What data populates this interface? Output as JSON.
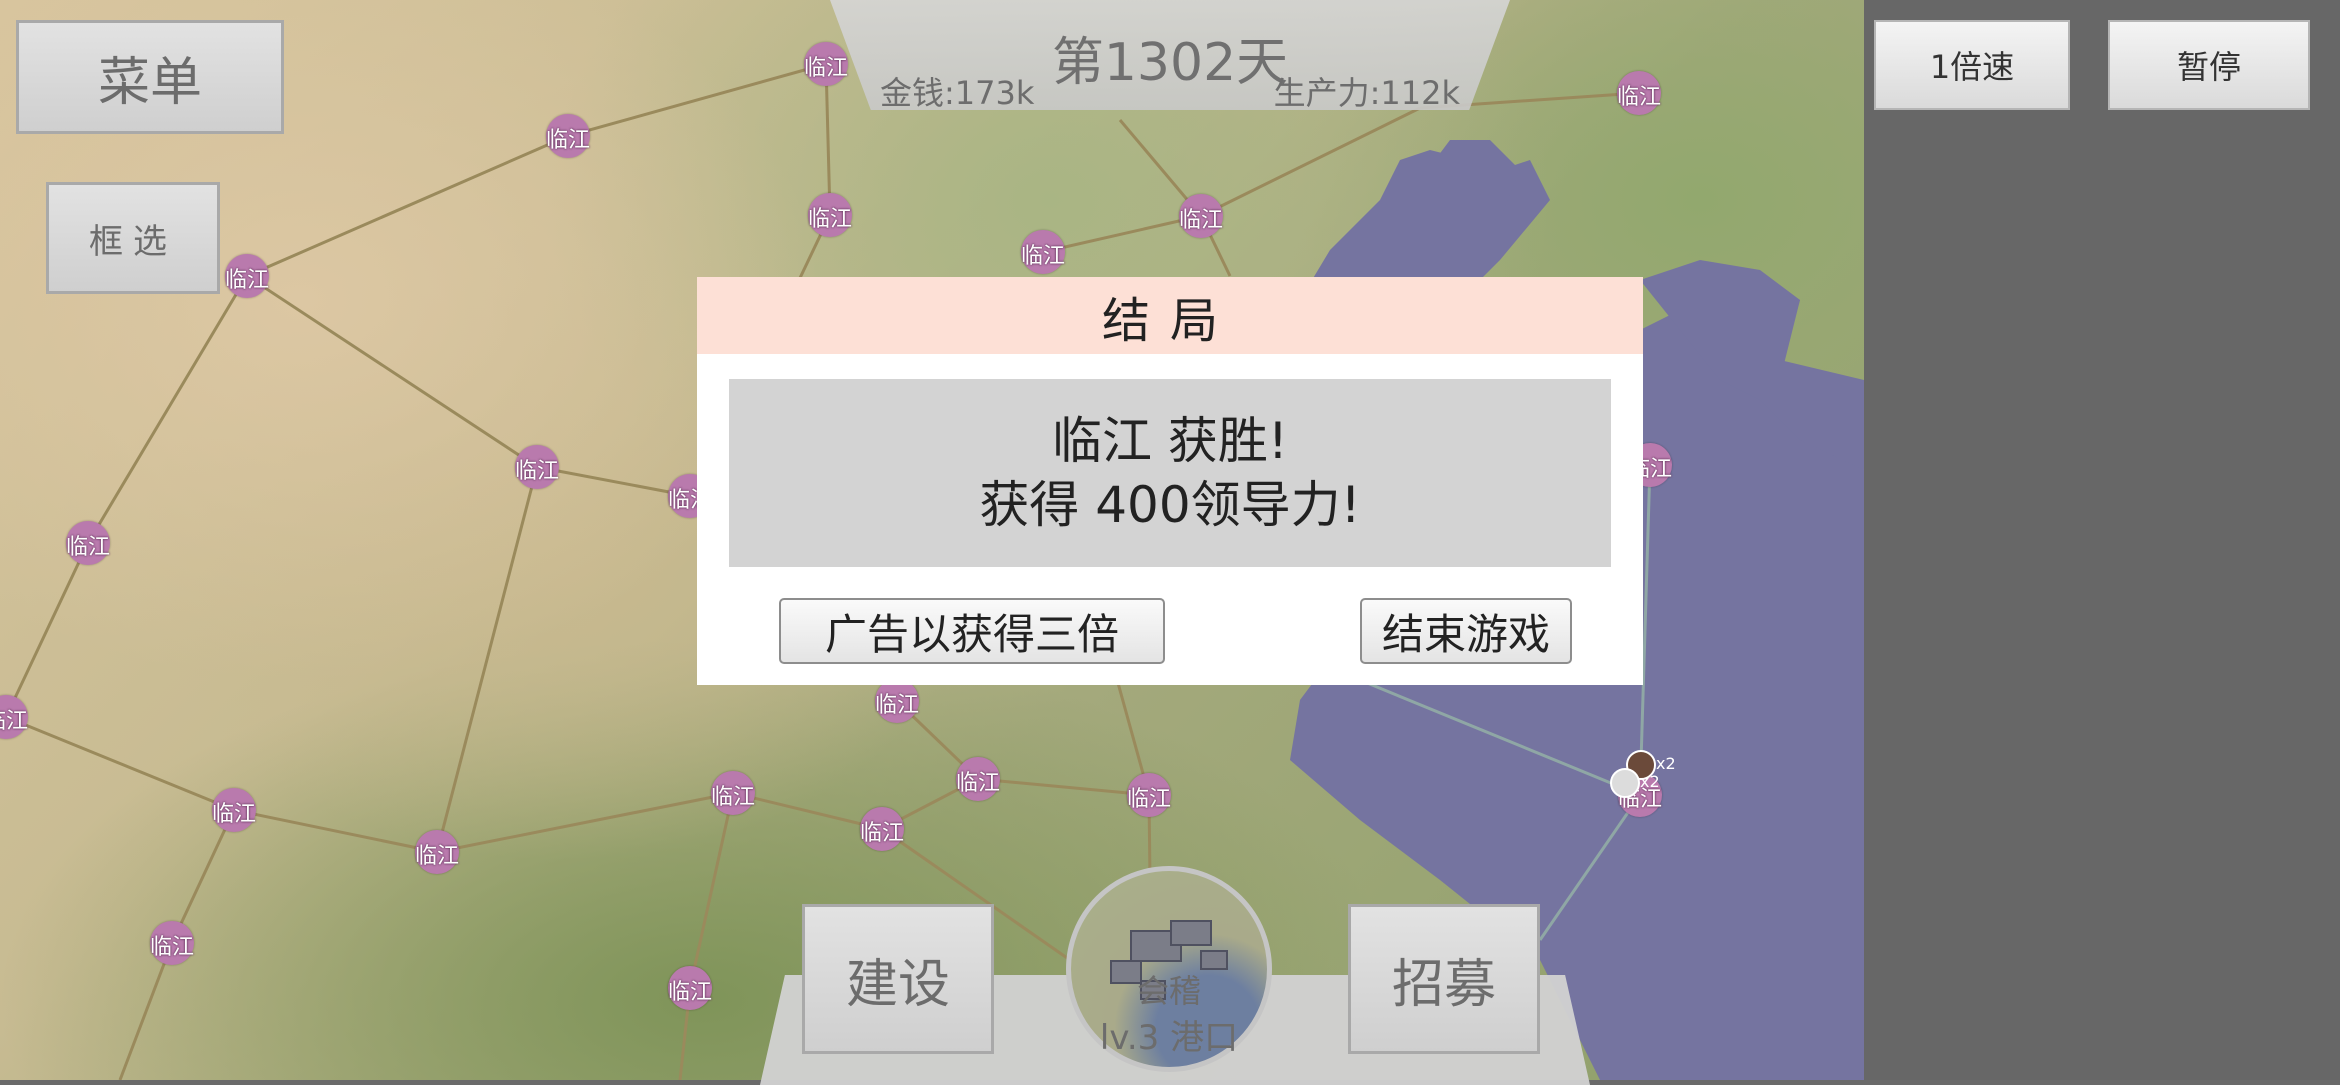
{
  "top": {
    "day": "第1302天",
    "money": "金钱:173k",
    "production": "生产力:112k"
  },
  "buttons": {
    "menu": "菜单",
    "select": "框选",
    "build": "建设",
    "recruit": "招募",
    "speed": "1倍速",
    "pause": "暂停"
  },
  "city_panel": {
    "name": "会稽",
    "level": "lv.3 港口"
  },
  "dialog": {
    "title": "结局",
    "line1": "临江 获胜!",
    "line2": "获得 400领导力!",
    "ad_button": "广告以获得三倍",
    "end_button": "结束游戏"
  },
  "map": {
    "city_label": "临江",
    "unit_count": "x2"
  },
  "colors": {
    "city_marker": "#b97aad",
    "sea": "#7574a0",
    "dialog_header": "#fde0d6"
  }
}
